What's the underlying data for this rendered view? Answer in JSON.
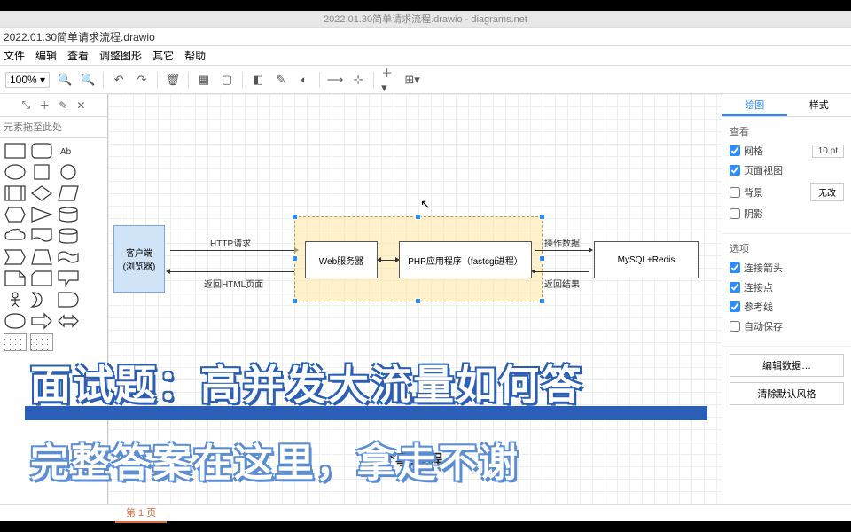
{
  "window": {
    "title": "2022.01.30简单请求流程.drawio - diagrams.net"
  },
  "file": {
    "name": "2022.01.30简单请求流程.drawio"
  },
  "menu": {
    "file": "文件",
    "edit": "编辑",
    "view": "查看",
    "adjust": "调整图形",
    "other": "其它",
    "help": "帮助"
  },
  "toolbar": {
    "zoom": "100%"
  },
  "leftPanel": {
    "searchPlaceholder": "元素拖至此处"
  },
  "canvas": {
    "client": "客户端\n(浏览器)",
    "web": "Web服务器",
    "php": "PHP应用程序（fastcgi进程）",
    "db": "MySQL+Redis",
    "e1_top": "HTTP请求",
    "e1_bot": "返回HTML页面",
    "e2_top": "操作数据",
    "e2_bot": "返回结果"
  },
  "rightPanel": {
    "tab1": "绘图",
    "tab2": "样式",
    "sec1": "查看",
    "grid": "网格",
    "gridSize": "10 pt",
    "pageView": "页面视图",
    "bg": "背景",
    "shadow": "阴影",
    "resetBtn": "无改",
    "sec2": "选项",
    "connArrows": "连接箭头",
    "connPoints": "连接点",
    "guides": "参考线",
    "autosave": "自动保存",
    "editData": "编辑数据…",
    "clearStyle": "清除默认风格"
  },
  "tabBar": {
    "page1": "第 1 页"
  },
  "captions": {
    "line1": "面试题：高并发大流量如何答",
    "line2": "完整答案在这里，拿走不谢",
    "sub": "个事:过程"
  }
}
